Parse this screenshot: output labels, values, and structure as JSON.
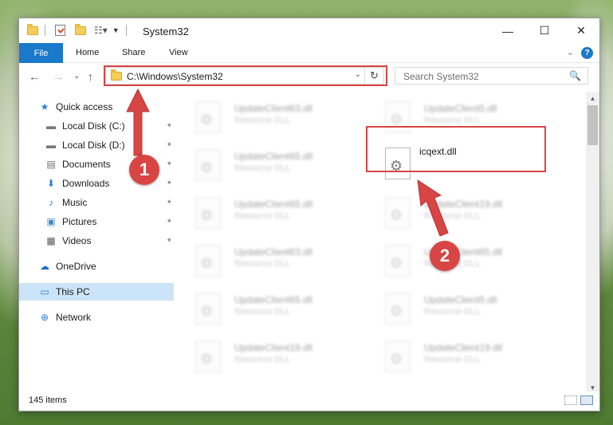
{
  "window": {
    "title": "System32",
    "minimize_glyph": "—",
    "maximize_glyph": "☐",
    "close_glyph": "✕"
  },
  "ribbon": {
    "tabs": [
      "File",
      "Home",
      "Share",
      "View"
    ],
    "help": "?",
    "expand": "⌄"
  },
  "nav": {
    "back": "←",
    "forward": "→",
    "recent": "⌄",
    "up": "↑",
    "address": "C:\\Windows\\System32",
    "address_dropdown": "⌄",
    "refresh": "↻",
    "search_placeholder": "Search System32",
    "search_icon": "🔍"
  },
  "sidebar": {
    "items": [
      {
        "label": "Quick access",
        "icon": "★",
        "pinned": false
      },
      {
        "label": "Local Disk (C:)",
        "icon": "▬",
        "pinned": true
      },
      {
        "label": "Local Disk (D:)",
        "icon": "▬",
        "pinned": true
      },
      {
        "label": "Documents",
        "icon": "▤",
        "pinned": true
      },
      {
        "label": "Downloads",
        "icon": "⬇",
        "pinned": true
      },
      {
        "label": "Music",
        "icon": "♪",
        "pinned": true
      },
      {
        "label": "Pictures",
        "icon": "▣",
        "pinned": true
      },
      {
        "label": "Videos",
        "icon": "▦",
        "pinned": true
      },
      {
        "label": "OneDrive",
        "icon": "☁",
        "pinned": false
      },
      {
        "label": "This PC",
        "icon": "▭",
        "pinned": false,
        "selected": true
      },
      {
        "label": "Network",
        "icon": "⊕",
        "pinned": false
      }
    ],
    "pin_glyph": "📌"
  },
  "files": {
    "left_column": [
      {
        "name": "UpdateClient63.dll",
        "type": "Resource DLL"
      },
      {
        "name": "UpdateClient65.dll",
        "type": "Resource DLL"
      },
      {
        "name": "UpdateClient65.dll",
        "type": "Resource DLL"
      },
      {
        "name": "UpdateClient63.dll",
        "type": "Resource DLL"
      },
      {
        "name": "UpdateClient65.dll",
        "type": "Resource DLL"
      },
      {
        "name": "UpdateClient19.dll",
        "type": "Resource DLL"
      }
    ],
    "right_column": [
      {
        "name": "UpdateClient5.dll",
        "type": "Resource DLL"
      },
      {
        "name": "icqext.dll",
        "type": ""
      },
      {
        "name": "UpdateClient19.dll",
        "type": "Resource DLL"
      },
      {
        "name": "UpdateClient65.dll",
        "type": "Resource DLL"
      },
      {
        "name": "UpdateClient5.dll",
        "type": "Resource DLL"
      },
      {
        "name": "UpdateClient19.dll",
        "type": "Resource DLL"
      }
    ]
  },
  "status": {
    "item_count": "145 items"
  },
  "annotations": {
    "marker_1": "1",
    "marker_2": "2",
    "color": "#d84545"
  }
}
